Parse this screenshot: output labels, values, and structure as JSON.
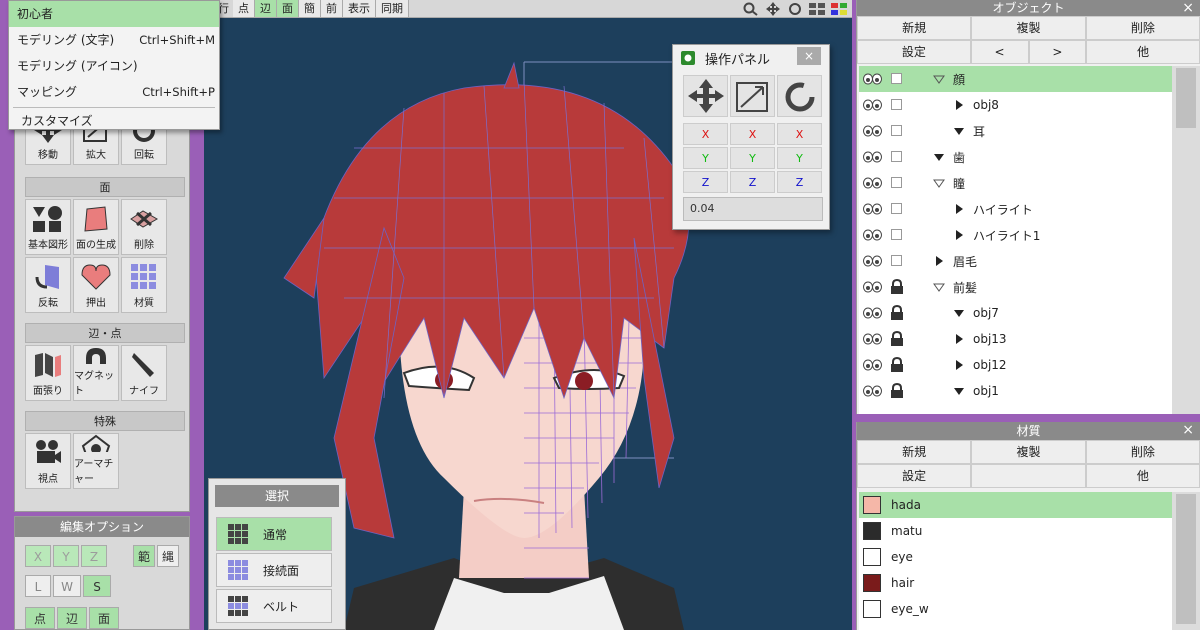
{
  "toolbar": {
    "partial_label": "行",
    "buttons": [
      "点",
      "辺",
      "面",
      "簡",
      "前",
      "表示",
      "同期"
    ],
    "active": [
      "辺",
      "面"
    ]
  },
  "mode_menu": {
    "items": [
      {
        "label": "初心者",
        "shortcut": "",
        "highlight": true
      },
      {
        "label": "モデリング (文字)",
        "shortcut": "Ctrl+Shift+M",
        "highlight": false
      },
      {
        "label": "モデリング (アイコン)",
        "shortcut": "",
        "highlight": false
      },
      {
        "label": "マッピング",
        "shortcut": "Ctrl+Shift+P",
        "highlight": false
      }
    ],
    "customize": "カスタマイズ"
  },
  "tools": {
    "transform": [
      "移動",
      "拡大",
      "回転"
    ],
    "face_head": "面",
    "face_row1": [
      "基本図形",
      "面の生成",
      "削除"
    ],
    "face_row2": [
      "反転",
      "押出",
      "材質"
    ],
    "edge_head": "辺・点",
    "edge_row": [
      "面張り",
      "マグネット",
      "ナイフ"
    ],
    "special_head": "特殊",
    "special_row": [
      "視点",
      "アーマチャー"
    ]
  },
  "edit_options": {
    "title": "編集オプション",
    "xyz": [
      "X",
      "Y",
      "Z"
    ],
    "range": "範",
    "rope": "縄",
    "lws": [
      "L",
      "W",
      "S"
    ],
    "modes": [
      "点",
      "辺",
      "面"
    ]
  },
  "select_panel": {
    "title": "選択",
    "items": [
      "通常",
      "接続面",
      "ベルト"
    ]
  },
  "op_panel": {
    "title": "操作パネル",
    "close": "×",
    "axes": [
      "X",
      "Y",
      "Z"
    ],
    "value": "0.04",
    "axis_colors": {
      "X": "#d11",
      "Y": "#1b1",
      "Z": "#11c"
    }
  },
  "objects": {
    "title": "オブジェクト",
    "close": "×",
    "buttons_row1": [
      "新規",
      "複製",
      "削除"
    ],
    "buttons_row2": [
      "設定",
      "<",
      ">",
      "他"
    ],
    "rows": [
      {
        "label": "顔",
        "indent": 0,
        "arrow": "open-outline",
        "locked": false,
        "highlight": true
      },
      {
        "label": "obj8",
        "indent": 1,
        "arrow": "right",
        "locked": false,
        "highlight": false
      },
      {
        "label": "耳",
        "indent": 1,
        "arrow": "down",
        "locked": false,
        "highlight": false
      },
      {
        "label": "歯",
        "indent": 0,
        "arrow": "down",
        "locked": false,
        "highlight": false
      },
      {
        "label": "瞳",
        "indent": 0,
        "arrow": "open-outline",
        "locked": false,
        "highlight": false
      },
      {
        "label": "ハイライト",
        "indent": 1,
        "arrow": "right",
        "locked": false,
        "highlight": false
      },
      {
        "label": "ハイライト1",
        "indent": 1,
        "arrow": "right",
        "locked": false,
        "highlight": false
      },
      {
        "label": "眉毛",
        "indent": 0,
        "arrow": "right",
        "locked": false,
        "highlight": false
      },
      {
        "label": "前髪",
        "indent": 0,
        "arrow": "open-outline",
        "locked": true,
        "highlight": false
      },
      {
        "label": "obj7",
        "indent": 1,
        "arrow": "down",
        "locked": true,
        "highlight": false
      },
      {
        "label": "obj13",
        "indent": 1,
        "arrow": "right",
        "locked": true,
        "highlight": false
      },
      {
        "label": "obj12",
        "indent": 1,
        "arrow": "right",
        "locked": true,
        "highlight": false
      },
      {
        "label": "obj1",
        "indent": 1,
        "arrow": "down",
        "locked": true,
        "highlight": false
      }
    ]
  },
  "materials": {
    "title": "材質",
    "close": "×",
    "buttons_row1": [
      "新規",
      "複製",
      "削除"
    ],
    "buttons_row2": [
      "設定",
      "",
      "他"
    ],
    "rows": [
      {
        "name": "hada",
        "color": "#f5b7a8",
        "highlight": true
      },
      {
        "name": "matu",
        "color": "#2b2b2b",
        "highlight": false
      },
      {
        "name": "eye",
        "color": "#ffffff",
        "highlight": false
      },
      {
        "name": "hair",
        "color": "#7a1b1b",
        "highlight": false
      },
      {
        "name": "eye_w",
        "color": "#ffffff",
        "highlight": false
      }
    ]
  },
  "colors": {
    "accent_green": "#a8e0a8",
    "viewport_bg": "#1d3f5c",
    "hair": "#b83a3a",
    "skin": "#f6d4cc",
    "wire": "#8a7ad8"
  }
}
